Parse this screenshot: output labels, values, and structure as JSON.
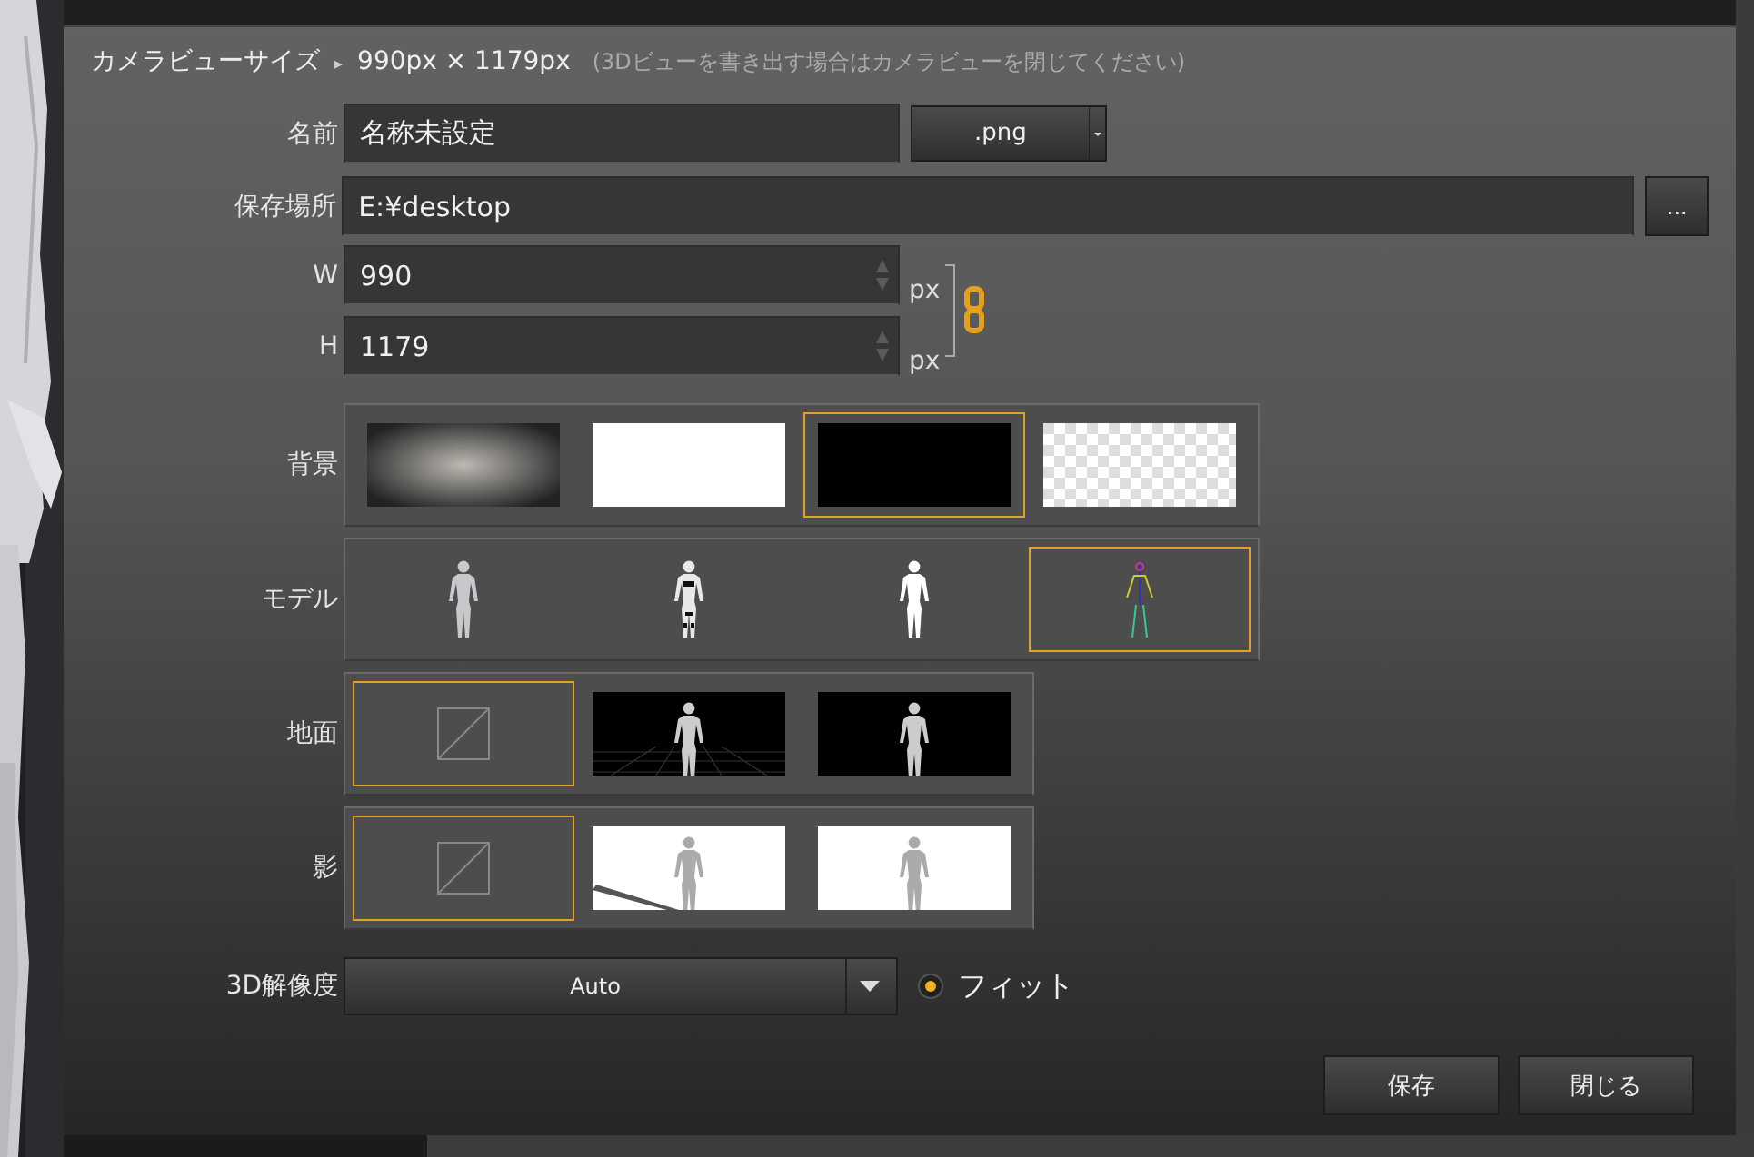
{
  "header": {
    "title": "カメラビューサイズ",
    "separator": "▸",
    "size": "990px × 1179px",
    "note": "(3Dビューを書き出す場合はカメラビューを閉じてください)"
  },
  "name": {
    "label": "名前",
    "value": "名称未設定",
    "format": ".png"
  },
  "location": {
    "label": "保存場所",
    "value": "E:¥desktop",
    "browse": "..."
  },
  "width": {
    "label": "W",
    "value": "990",
    "unit": "px"
  },
  "height": {
    "label": "H",
    "value": "1179",
    "unit": "px"
  },
  "option_groups": [
    {
      "label": "背景",
      "items": [
        {
          "kind": "gradient",
          "selected": false
        },
        {
          "kind": "white",
          "selected": false
        },
        {
          "kind": "black",
          "selected": true
        },
        {
          "kind": "transparent",
          "selected": false
        }
      ]
    },
    {
      "label": "モデル",
      "items": [
        {
          "kind": "shaded",
          "selected": false
        },
        {
          "kind": "mannequin",
          "selected": false
        },
        {
          "kind": "flat",
          "selected": false
        },
        {
          "kind": "skeleton",
          "selected": true
        }
      ]
    },
    {
      "label": "地面",
      "items": [
        {
          "kind": "none",
          "selected": true
        },
        {
          "kind": "grid",
          "selected": false
        },
        {
          "kind": "dark",
          "selected": false
        }
      ]
    },
    {
      "label": "影",
      "items": [
        {
          "kind": "none",
          "selected": true
        },
        {
          "kind": "shadow",
          "selected": false
        },
        {
          "kind": "plain",
          "selected": false
        }
      ]
    }
  ],
  "resolution": {
    "label": "3D解像度",
    "value": "Auto",
    "fit_label": "フィット",
    "fit_selected": true
  },
  "buttons": [
    "保存",
    "閉じる"
  ]
}
